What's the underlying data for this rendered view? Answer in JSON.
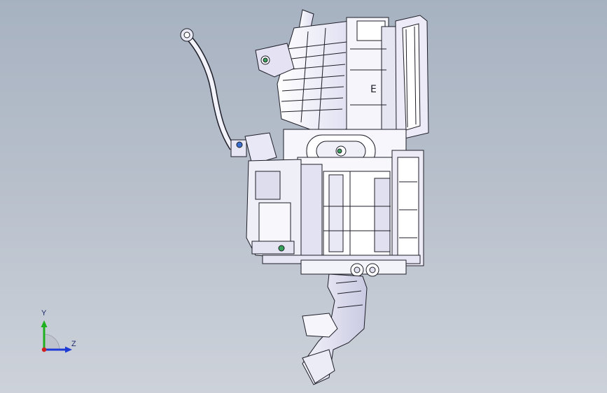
{
  "viewport": {
    "background_top": "#a7b2c1",
    "background_bottom": "#cdd2da",
    "model": "hvac-unit-assembly"
  },
  "triad": {
    "y_label": "Y",
    "z_label": "Z",
    "colors": {
      "y": "#1fb01f",
      "z": "#1f3bd6",
      "x": "#d01f1f"
    }
  }
}
